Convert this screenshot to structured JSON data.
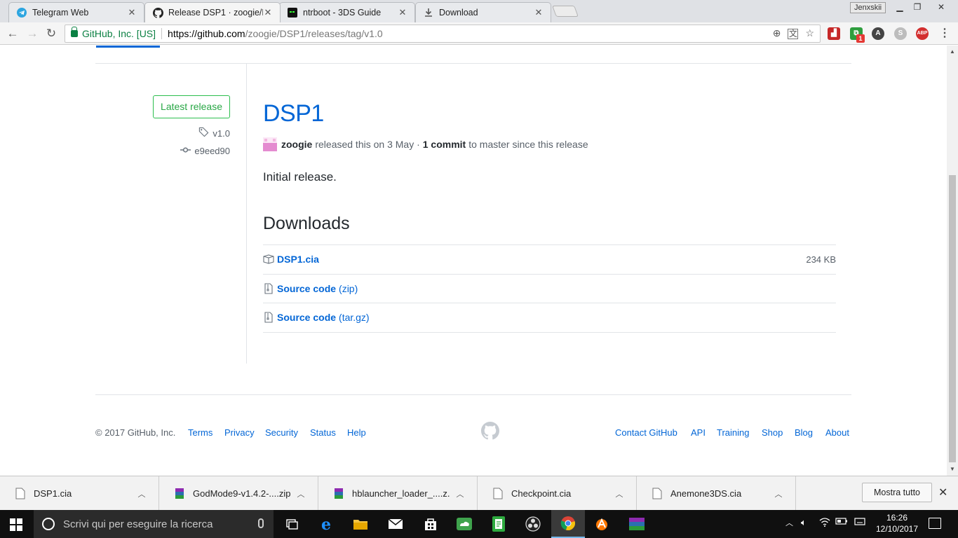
{
  "browser": {
    "tabs": [
      {
        "title": "Telegram Web"
      },
      {
        "title": "Release DSP1 · zoogie/D",
        "active": true
      },
      {
        "title": "ntrboot - 3DS Guide"
      },
      {
        "title": "Download"
      }
    ],
    "profile": "Jenxskii",
    "omnibox": {
      "org": "GitHub, Inc. [US]",
      "url_host": "https://github.com",
      "url_path": "/zoogie/DSP1/releases/tag/v1.0"
    },
    "extension_badge": "1",
    "abp": "ABP"
  },
  "release": {
    "latest_label": "Latest release",
    "tag": "v1.0",
    "commit": "e9eed90",
    "title": "DSP1",
    "author": "zoogie",
    "released_text": "released this on 3 May ·",
    "commits": "1 commit",
    "since_text": "to master since this release",
    "body": "Initial release.",
    "downloads_heading": "Downloads",
    "assets": [
      {
        "name": "DSP1.cia",
        "suffix": "",
        "size": "234 KB",
        "icon": "package-icon"
      },
      {
        "name": "Source code",
        "suffix": "(zip)",
        "size": "",
        "icon": "file-zip-icon"
      },
      {
        "name": "Source code",
        "suffix": "(tar.gz)",
        "size": "",
        "icon": "file-zip-icon"
      }
    ]
  },
  "footer": {
    "copyright": "© 2017 GitHub, Inc.",
    "left_links": [
      "Terms",
      "Privacy",
      "Security",
      "Status",
      "Help"
    ],
    "right_links": [
      "Contact GitHub",
      "API",
      "Training",
      "Shop",
      "Blog",
      "About"
    ]
  },
  "download_shelf": {
    "items": [
      "DSP1.cia",
      "GodMode9-v1.4.2-....zip",
      "hblauncher_loader_....z...",
      "Checkpoint.cia",
      "Anemone3DS.cia"
    ],
    "show_all": "Mostra tutto"
  },
  "taskbar": {
    "search_placeholder": "Scrivi qui per eseguire la ricerca",
    "time": "16:26",
    "date": "12/10/2017"
  },
  "colors": {
    "link": "#0366d6",
    "green": "#28a745",
    "muted": "#586069"
  }
}
